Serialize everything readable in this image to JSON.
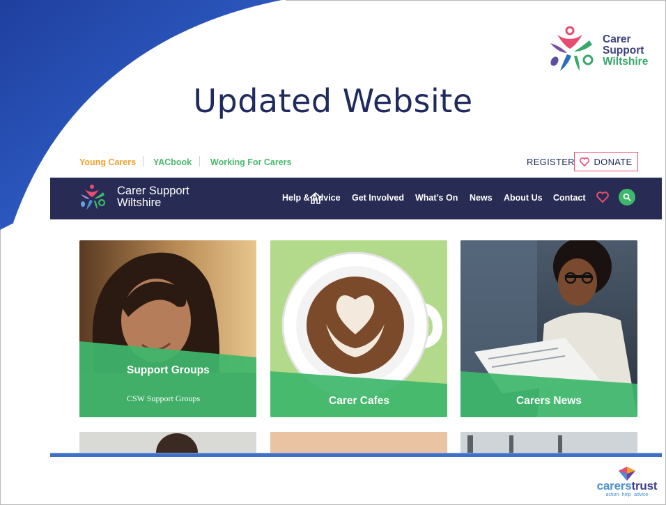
{
  "slide": {
    "title": "Updated Website",
    "logo_top": {
      "line1": "Carer",
      "line2": "Support",
      "line3": "Wiltshire"
    },
    "logo_bottom": {
      "name_part1": "carers",
      "name_part2": "trust",
      "tagline": "action· help ·advice"
    }
  },
  "site": {
    "topbar": {
      "links": [
        "Young Carers",
        "YACbook",
        "Working For Carers"
      ],
      "register": "REGISTER",
      "donate": "DONATE"
    },
    "nav": {
      "logo_line1": "Carer Support",
      "logo_line2": "Wiltshire",
      "items": [
        "Help & Advice",
        "Get Involved",
        "What’s On",
        "News",
        "About Us",
        "Contact"
      ]
    },
    "cards": [
      {
        "title": "Support Groups",
        "subtitle": "CSW Support Groups"
      },
      {
        "title": "Carer Cafes"
      },
      {
        "title": "Carers News"
      }
    ]
  },
  "colors": {
    "navy": "#282b53",
    "green": "#3eb76c",
    "pink": "#e94c72",
    "orange": "#f4a12b",
    "slide_title": "#1f2a5e"
  }
}
